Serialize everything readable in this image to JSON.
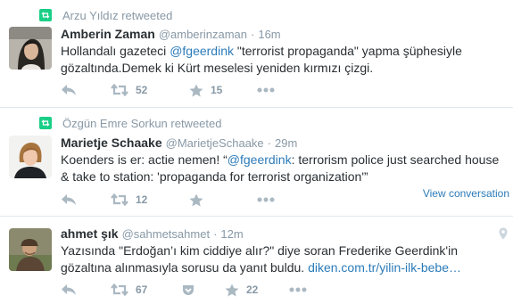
{
  "tweets": [
    {
      "retweeted_by": "Arzu Yıldız retweeted",
      "fullname": "Amberin Zaman",
      "handle": "@amberinzaman",
      "time": "16m",
      "text_pre": "Hollandalı gazeteci ",
      "mention": "@fgeerdink",
      "text_post": " \"terrorist propaganda\" yapma şüphesiyle gözaltında.Demek ki Kürt meselesi yeniden kırmızı çizgi.",
      "retweets": "52",
      "favorites": "15"
    },
    {
      "retweeted_by": "Özgün Emre Sorkun retweeted",
      "fullname": "Marietje Schaake",
      "handle": "@MarietjeSchaake",
      "time": "29m",
      "text_pre": "Koenders is er: actie nemen! “",
      "mention": "@fgeerdink",
      "text_post": ": terrorism police just searched house & take to station: 'propaganda for terrorist organization'”",
      "retweets": "12",
      "view_conversation": "View conversation"
    },
    {
      "fullname": "ahmet şık",
      "handle": "@sahmetsahmet",
      "time": "12m",
      "text_pre": "Yazısında \"Erdoğan’ı kim ciddiye alır?\" diye soran Frederike Geerdink'in gözaltına alınmasıyla sorusu da yanıt buldu. ",
      "link": "diken.com.tr/yilin-ilk-bebe…",
      "retweets": "67",
      "favorites": "22"
    }
  ],
  "icons": {
    "reply": "reply-icon",
    "retweet": "retweet-icon",
    "favorite": "star-icon",
    "more": "more-icon",
    "pocket": "pocket-icon",
    "location": "location-icon",
    "retweet_badge": "retweet-badge-icon"
  },
  "colors": {
    "link": "#2b7bb9",
    "retweet_green": "#19cf86",
    "meta_gray": "#8899a6",
    "text": "#292f33",
    "icon_gray": "#aab8c2"
  }
}
